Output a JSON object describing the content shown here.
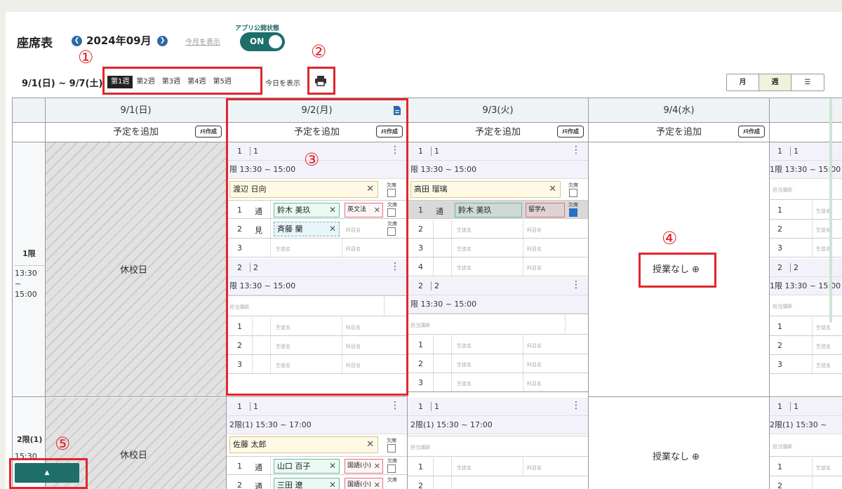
{
  "header": {
    "title": "座席表",
    "month": "2024年09月",
    "show_this_month": "今月を表示",
    "publish_label": "アプリ公開状態",
    "publish_toggle": "ON"
  },
  "week_bar": {
    "range": "9/1(日) ~ 9/7(土)",
    "weeks": [
      "第1週",
      "第2週",
      "第3週",
      "第4週",
      "第5週"
    ],
    "active_week": "第1週",
    "show_today": "今日を表示"
  },
  "views": [
    "月",
    "週",
    "☰"
  ],
  "active_view": "週",
  "add_schedule": "予定を追加",
  "memo_button": "ﾒﾓ作成",
  "kesseki": "欠席",
  "closed_day": "休校日",
  "no_lesson": "授業なし ⊕",
  "periods": [
    {
      "name": "1限",
      "time": "13:30 ~ 15:00"
    },
    {
      "name": "2限(1)",
      "time": "15:30"
    }
  ],
  "placeholders": {
    "student": "生徒名",
    "subject": "科目名",
    "teacher": "担当講師"
  },
  "days": [
    {
      "date": "9/1(日)"
    },
    {
      "date": "9/2(月)"
    },
    {
      "date": "9/3(火)"
    },
    {
      "date": "9/4(水)"
    },
    {
      "date": ""
    }
  ],
  "slots": {
    "slot1": {
      "num": "1",
      "sub": "1"
    },
    "slot2": {
      "num": "2",
      "sub": "2"
    },
    "p1_time": "限 13:30 ~ 15:00",
    "p1_time_full": "1限 13:30 ~ 15:00",
    "p2_time": "2限(1) 15:30 ~ 17:00",
    "p2_time_cut": "2限(1) 15:30 ~"
  },
  "mon": {
    "teacher1": "渡辺 日向",
    "row1": {
      "no": "1",
      "type": "通",
      "student": "鈴木 美玖",
      "subject": "英文法"
    },
    "row2": {
      "no": "2",
      "type": "見",
      "student": "斉藤 蘭"
    },
    "row3": {
      "no": "3"
    },
    "teacher2": "佐藤 太郎",
    "p2row1": {
      "no": "1",
      "type": "通",
      "student": "山口 百子",
      "subject": "国語(小)"
    },
    "p2row2": {
      "no": "2",
      "type": "通",
      "student": "三田 遼",
      "subject": "国語(小)"
    }
  },
  "tue": {
    "teacher1": "高田 瑠璃",
    "row1": {
      "no": "1",
      "type": "通",
      "student": "鈴木 美玖",
      "subject": "留学A"
    },
    "rows": [
      "2",
      "3",
      "4"
    ],
    "slot2_rows": [
      "1",
      "2",
      "3"
    ]
  },
  "seat_numbers": [
    "1",
    "2",
    "3"
  ],
  "callouts": [
    "①",
    "②",
    "③",
    "④",
    "⑤"
  ],
  "up_button": "▲"
}
